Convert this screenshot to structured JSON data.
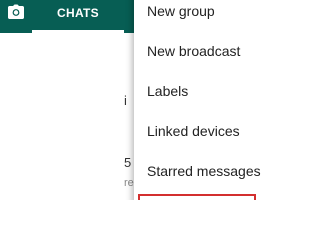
{
  "tabs": {
    "camera_icon": "camera-icon",
    "chats_label": "CHATS"
  },
  "background_fragments": [
    "i",
    "5",
    "re"
  ],
  "menu": {
    "items": [
      {
        "label": "New group"
      },
      {
        "label": "New broadcast"
      },
      {
        "label": "Labels"
      },
      {
        "label": "Linked devices"
      },
      {
        "label": "Starred messages"
      }
    ]
  },
  "colors": {
    "header": "#075e54",
    "highlight": "#d32f2f"
  }
}
